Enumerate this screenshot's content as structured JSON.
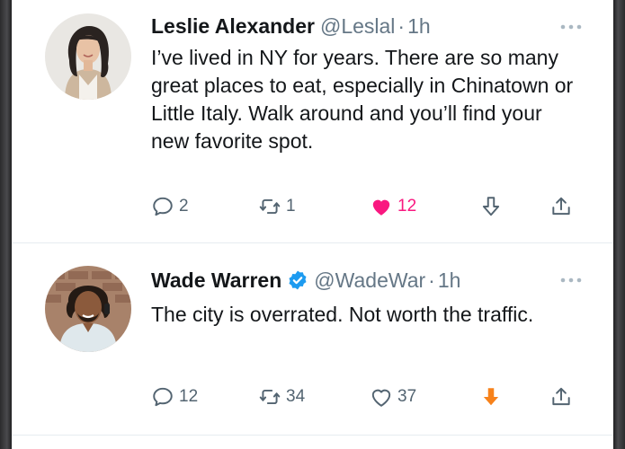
{
  "tweets": [
    {
      "author_name": "Leslie Alexander",
      "handle": "@Leslal",
      "separator": "·",
      "time": "1h",
      "verified": false,
      "text": "I’ve lived in NY for years. There are so many great places to eat, especially in Chinatown or Little Italy. Walk around and you’ll find your new favorite spot.",
      "replies": "2",
      "retweets": "1",
      "likes": "12",
      "liked": true,
      "downvoted": false
    },
    {
      "author_name": "Wade Warren",
      "handle": "@WadeWar",
      "separator": "·",
      "time": "1h",
      "verified": true,
      "text": "The city is overrated. Not worth the traffic.",
      "replies": "12",
      "retweets": "34",
      "likes": "37",
      "liked": false,
      "downvoted": true
    }
  ],
  "colors": {
    "like_active": "#f91880",
    "downvote_active": "#f7821b",
    "verified": "#1d9bf0",
    "icon_default": "#536471"
  },
  "icons": [
    "reply-icon",
    "retweet-icon",
    "heart-icon",
    "downvote-icon",
    "share-icon",
    "more-icon",
    "verified-badge-icon"
  ]
}
